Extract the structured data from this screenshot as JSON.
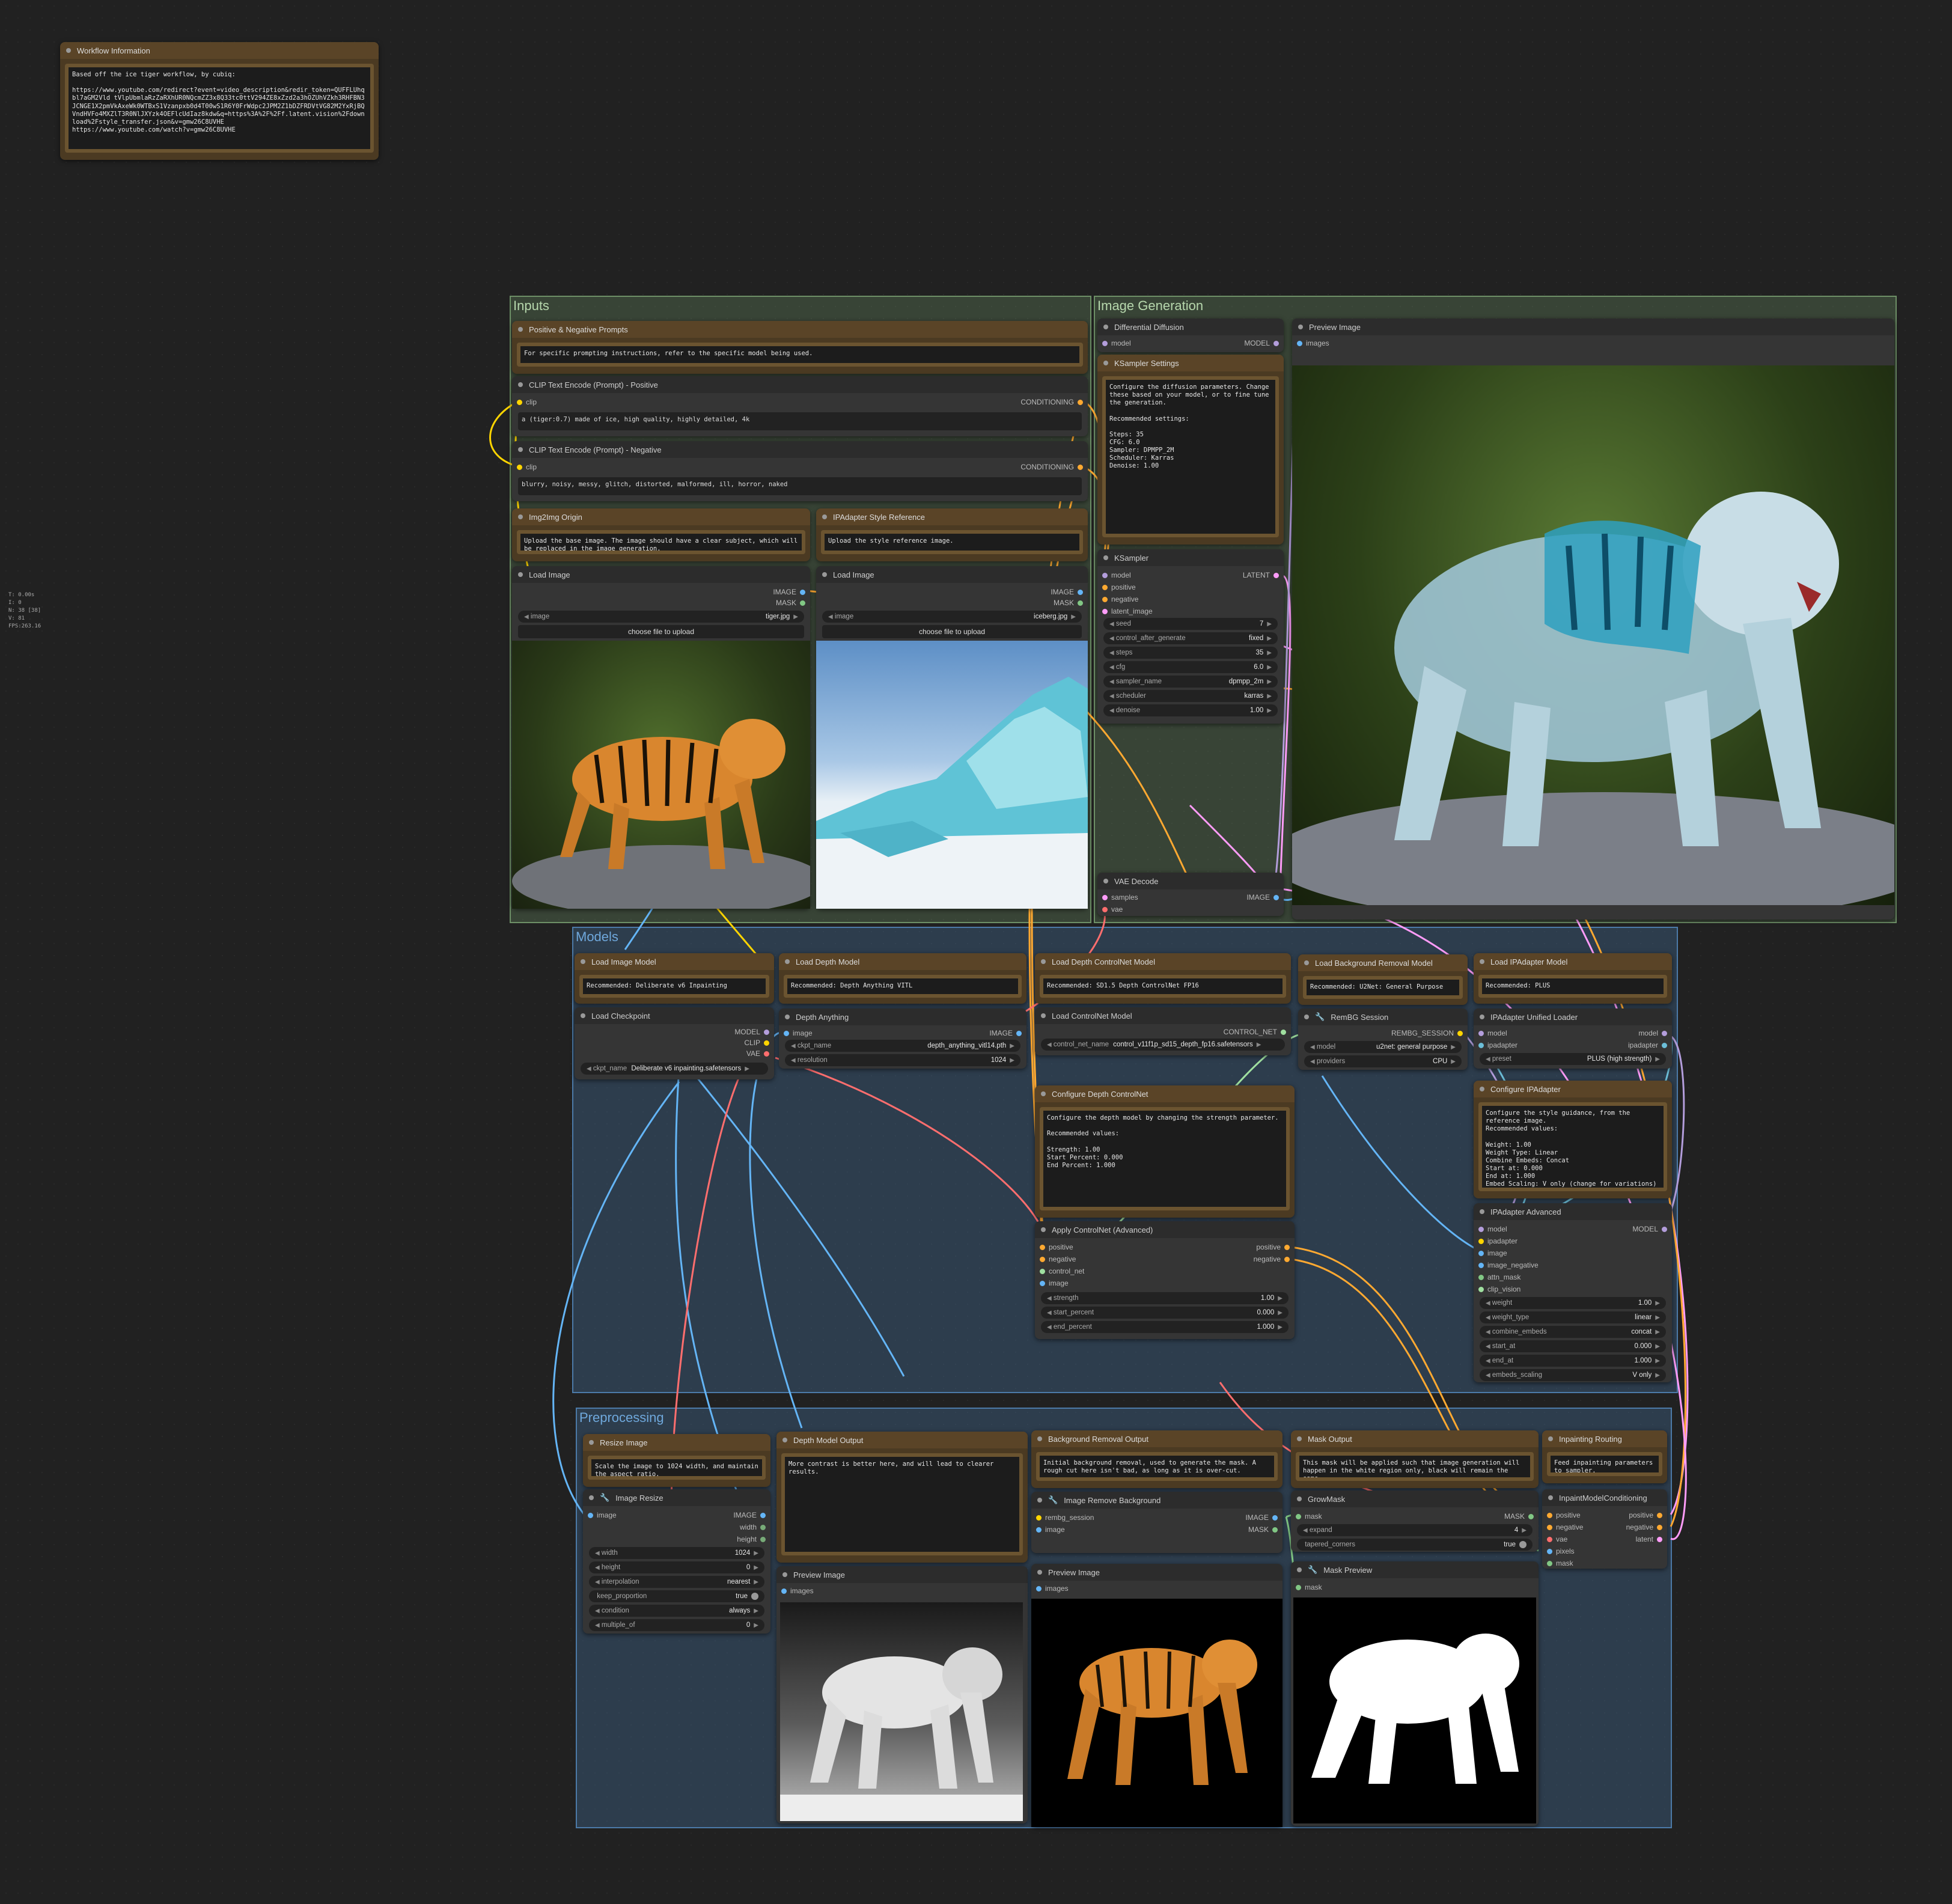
{
  "colors": {
    "clip": "#ffd500",
    "conditioning": "#ffa931",
    "image": "#64b5f6",
    "mask": "#81c784",
    "model": "#b39ddb",
    "latent": "#ff9cf9",
    "vae": "#ff6e6e",
    "control_net": "#a0e0a0",
    "ipadapter": "#6cbed8"
  },
  "stats": {
    "l1": "T: 0.00s",
    "l2": "I: 0",
    "l3": "N: 38 [38]",
    "l4": "V: 81",
    "l5": "FPS:263.16"
  },
  "workflow_info": {
    "title": "Workflow Information",
    "text": "Based off the ice tiger workflow, by cubiq:\n\nhttps://www.youtube.com/redirect?event=video_description&redir_token=QUFFLUhqbl7aGM2Vld tVlpUbmlaRzZaRXhUR0NQcmZZ3x8Q33tc0ttV294ZE8xZzd2a3hOZUhVZkh3RHFBN3JCNGE1X2pmVkAxeWk0WTBxS1Vzanpxb0d4T00wS1R6Y0FrWdpc2JPM2Z1bDZFRDVtVG82M2YxRjBQVndHVFo4MXZlT3R0NlJXYzk4OEFlcUdIaz8kdw&q=https%3A%2F%2Ff.latent.vision%2Fdownload%2Fstyle_transfer.json&v=gmw26C8UVHE\nhttps://www.youtube.com/watch?v=gmw26C8UVHE"
  },
  "groups": {
    "inputs": "Inputs",
    "image_generation": "Image Generation",
    "models": "Models",
    "preprocessing": "Preprocessing"
  },
  "prompts_note": {
    "title": "Positive & Negative Prompts",
    "text": "For specific prompting instructions, refer to the specific model being used."
  },
  "clip_pos": {
    "title": "CLIP Text Encode (Prompt) - Positive",
    "in": "clip",
    "out": "CONDITIONING",
    "text": "a (tiger:0.7) made of ice, high quality, highly detailed, 4k"
  },
  "clip_neg": {
    "title": "CLIP Text Encode (Prompt) - Negative",
    "in": "clip",
    "out": "CONDITIONING",
    "text": "blurry, noisy, messy, glitch, distorted, malformed, ill, horror, naked"
  },
  "img2img_note": {
    "title": "Img2Img Origin",
    "text": "Upload the base image. The image should have a clear subject, which will be replaced in the image generation."
  },
  "ipa_style_note": {
    "title": "IPAdapter Style Reference",
    "text": "Upload the style reference image."
  },
  "load_image1": {
    "title": "Load Image",
    "out1": "IMAGE",
    "out2": "MASK",
    "w_label": "image",
    "w_value": "tiger.jpg",
    "button": "choose file to upload"
  },
  "load_image2": {
    "title": "Load Image",
    "out1": "IMAGE",
    "out2": "MASK",
    "w_label": "image",
    "w_value": "iceberg.jpg",
    "button": "choose file to upload"
  },
  "diff_diffusion": {
    "title": "Differential Diffusion",
    "in": "model",
    "out": "MODEL"
  },
  "ksampler_note": {
    "title": "KSampler Settings",
    "text": "Configure the diffusion parameters. Change these based on your model, or to fine tune the generation.\n\nRecommended settings:\n\nSteps: 35\nCFG: 6.0\nSampler: DPMPP_2M\nScheduler: Karras\nDenoise: 1.00"
  },
  "ksampler": {
    "title": "KSampler",
    "inputs": [
      "model",
      "positive",
      "negative",
      "latent_image"
    ],
    "out": "LATENT",
    "widgets": [
      {
        "l": "seed",
        "v": "7"
      },
      {
        "l": "control_after_generate",
        "v": "fixed"
      },
      {
        "l": "steps",
        "v": "35"
      },
      {
        "l": "cfg",
        "v": "6.0"
      },
      {
        "l": "sampler_name",
        "v": "dpmpp_2m"
      },
      {
        "l": "scheduler",
        "v": "karras"
      },
      {
        "l": "denoise",
        "v": "1.00"
      }
    ]
  },
  "preview_main": {
    "title": "Preview Image",
    "in": "images"
  },
  "vae_decode": {
    "title": "VAE Decode",
    "in1": "samples",
    "in2": "vae",
    "out": "IMAGE"
  },
  "load_image_model_note": {
    "title": "Load Image Model",
    "text": "Recommended: Deliberate v6 Inpainting"
  },
  "load_checkpoint": {
    "title": "Load Checkpoint",
    "out1": "MODEL",
    "out2": "CLIP",
    "out3": "VAE",
    "w_label": "ckpt_name",
    "w_value": "Deliberate v6 inpainting.safetensors"
  },
  "load_depth_note": {
    "title": "Load Depth Model",
    "text": "Recommended: Depth Anything VITL"
  },
  "depth_anything": {
    "title": "Depth Anything",
    "in": "image",
    "out": "IMAGE",
    "w1_label": "ckpt_name",
    "w1_value": "depth_anything_vitl14.pth",
    "w2_label": "resolution",
    "w2_value": "1024"
  },
  "load_depth_cn_note": {
    "title": "Load Depth ControlNet Model",
    "text": "Recommended: SD1.5 Depth ControlNet FP16"
  },
  "load_controlnet": {
    "title": "Load ControlNet Model",
    "out": "CONTROL_NET",
    "w_label": "control_net_name",
    "w_value": "control_v11f1p_sd15_depth_fp16.safetensors"
  },
  "config_depth_cn_note": {
    "title": "Configure Depth ControlNet",
    "text": "Configure the depth model by changing the strength parameter.\n\nRecommended values:\n\nStrength: 1.00\nStart Percent: 0.000\nEnd Percent: 1.000"
  },
  "apply_controlnet": {
    "title": "Apply ControlNet (Advanced)",
    "inputs": [
      "positive",
      "negative",
      "control_net",
      "image"
    ],
    "out1": "positive",
    "out2": "negative",
    "widgets": [
      {
        "l": "strength",
        "v": "1.00"
      },
      {
        "l": "start_percent",
        "v": "0.000"
      },
      {
        "l": "end_percent",
        "v": "1.000"
      }
    ]
  },
  "load_bg_note": {
    "title": "Load Background Removal Model",
    "text": "Recommended: U2Net: General Purpose"
  },
  "rembg_session": {
    "title": "RemBG Session",
    "out": "REMBG_SESSION",
    "w1_label": "model",
    "w1_value": "u2net: general purpose",
    "w2_label": "providers",
    "w2_value": "CPU"
  },
  "load_ipa_note": {
    "title": "Load IPAdapter Model",
    "text": "Recommended: PLUS"
  },
  "ipa_unified": {
    "title": "IPAdapter Unified Loader",
    "in1": "model",
    "in2": "ipadapter",
    "out1": "model",
    "out2": "ipadapter",
    "w_label": "preset",
    "w_value": "PLUS (high strength)"
  },
  "config_ipa_note": {
    "title": "Configure IPAdapter",
    "text": "Configure the style guidance, from the reference image.\nRecommended values:\n\nWeight: 1.00\nWeight Type: Linear\nCombine Embeds: Concat\nStart at: 0.000\nEnd at: 1.000\nEmbed Scaling: V only (change for variations)"
  },
  "ipa_advanced": {
    "title": "IPAdapter Advanced",
    "inputs": [
      "model",
      "ipadapter",
      "image",
      "image_negative",
      "attn_mask",
      "clip_vision"
    ],
    "out": "MODEL",
    "widgets": [
      {
        "l": "weight",
        "v": "1.00"
      },
      {
        "l": "weight_type",
        "v": "linear"
      },
      {
        "l": "combine_embeds",
        "v": "concat"
      },
      {
        "l": "start_at",
        "v": "0.000"
      },
      {
        "l": "end_at",
        "v": "1.000"
      },
      {
        "l": "embeds_scaling",
        "v": "V only"
      }
    ]
  },
  "resize_note": {
    "title": "Resize Image",
    "text": "Scale the image to 1024 width, and maintain the aspect ratio."
  },
  "image_resize": {
    "title": "Image Resize",
    "in": "image",
    "out1": "IMAGE",
    "out2": "width",
    "out3": "height",
    "widgets": [
      {
        "l": "width",
        "v": "1024"
      },
      {
        "l": "height",
        "v": "0"
      },
      {
        "l": "interpolation",
        "v": "nearest"
      },
      {
        "l": "keep_proportion",
        "v": "true"
      },
      {
        "l": "condition",
        "v": "always"
      },
      {
        "l": "multiple_of",
        "v": "0"
      }
    ]
  },
  "depth_output_note": {
    "title": "Depth Model Output",
    "text": "More contrast is better here, and will lead to clearer results."
  },
  "preview_depth": {
    "title": "Preview Image",
    "in": "images"
  },
  "bg_output_note": {
    "title": "Background Removal Output",
    "text": "Initial background removal, used to generate the mask. A rough cut here isn't bad, as long as it is over-cut."
  },
  "image_remove_bg": {
    "title": "Image Remove Background",
    "in1": "rembg_session",
    "in2": "image",
    "out1": "IMAGE",
    "out2": "MASK"
  },
  "preview_bg": {
    "title": "Preview Image",
    "in": "images"
  },
  "mask_output_note": {
    "title": "Mask Output",
    "text": "This mask will be applied such that image generation will happen in the white region only, black will remain the same."
  },
  "grow_mask": {
    "title": "GrowMask",
    "in": "mask",
    "out": "MASK",
    "w1_label": "expand",
    "w1_value": "4",
    "w2_label": "tapered_corners",
    "w2_value": "true"
  },
  "mask_preview": {
    "title": "Mask Preview",
    "in": "mask"
  },
  "inpaint_routing_note": {
    "title": "Inpainting Routing",
    "text": "Feed inpainting parameters to sampler."
  },
  "inpaint_cond": {
    "title": "InpaintModelConditioning",
    "inputs": [
      "positive",
      "negative",
      "vae",
      "pixels",
      "mask"
    ],
    "out1": "positive",
    "out2": "negative",
    "out3": "latent"
  }
}
